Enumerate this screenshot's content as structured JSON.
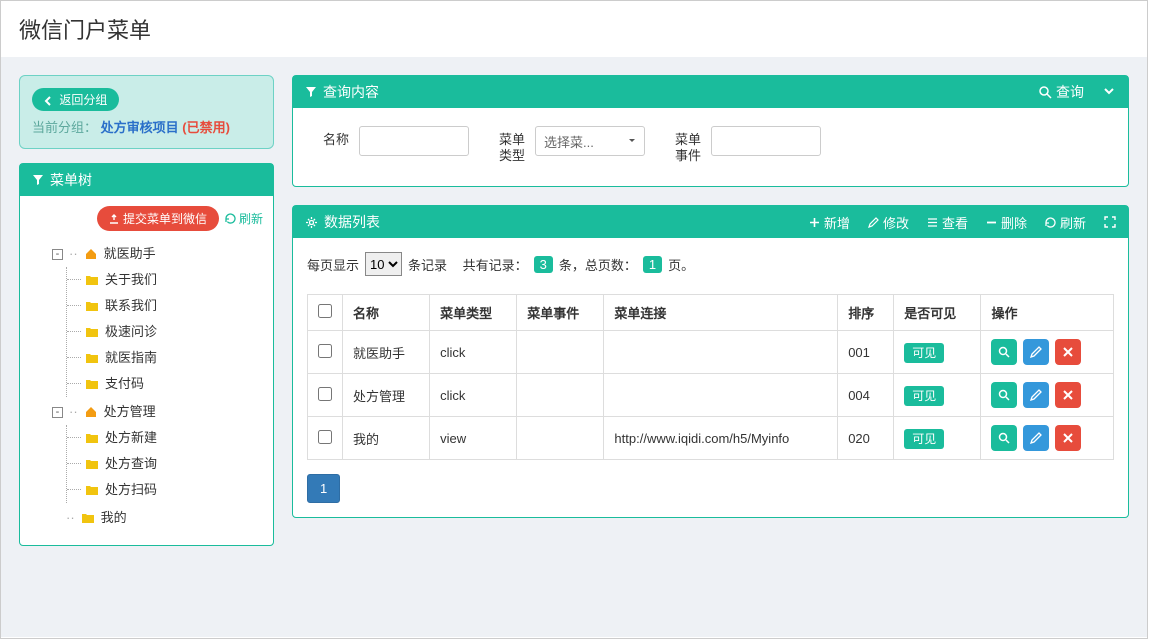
{
  "page_title": "微信门户菜单",
  "info_box": {
    "back_label": "返回分组",
    "current_label": "当前分组：",
    "group_name": "处方审核项目",
    "disabled": "(已禁用)"
  },
  "tree_panel": {
    "title": "菜单树",
    "submit_label": "提交菜单到微信",
    "refresh_label": "刷新",
    "roots": [
      {
        "label": "就医助手",
        "children": [
          "关于我们",
          "联系我们",
          "极速问诊",
          "就医指南",
          "支付码"
        ]
      },
      {
        "label": "处方管理",
        "children": [
          "处方新建",
          "处方查询",
          "处方扫码"
        ]
      }
    ],
    "extra_leaf": "我的"
  },
  "search_panel": {
    "title": "查询内容",
    "query_label": "查询",
    "fields": {
      "name_label": "名称",
      "type_label": "菜单\n类型",
      "type_placeholder": "选择菜...",
      "event_label": "菜单\n事件"
    }
  },
  "data_panel": {
    "title": "数据列表",
    "toolbar": {
      "add": "新增",
      "edit": "修改",
      "view": "查看",
      "del": "删除",
      "refresh": "刷新"
    },
    "records_line": {
      "per_page_prefix": "每页显示",
      "per_page_value": "10",
      "per_page_suffix": "条记录",
      "total_prefix": "共有记录：",
      "total_count": "3",
      "total_mid": "条，总页数：",
      "page_count": "1",
      "page_suffix": "页。"
    },
    "columns": [
      "名称",
      "菜单类型",
      "菜单事件",
      "菜单连接",
      "排序",
      "是否可见",
      "操作"
    ],
    "rows": [
      {
        "name": "就医助手",
        "type": "click",
        "event": "",
        "link": "",
        "sort": "001",
        "visible": "可见"
      },
      {
        "name": "处方管理",
        "type": "click",
        "event": "",
        "link": "",
        "sort": "004",
        "visible": "可见"
      },
      {
        "name": "我的",
        "type": "view",
        "event": "",
        "link": "http://www.iqidi.com/h5/Myinfo",
        "sort": "020",
        "visible": "可见"
      }
    ],
    "pager_current": "1"
  }
}
